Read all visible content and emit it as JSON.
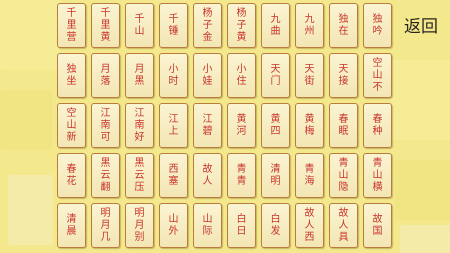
{
  "back_button": "返回",
  "cards": [
    [
      "千",
      "里",
      "营"
    ],
    [
      "千",
      "里",
      "黄"
    ],
    [
      "千",
      "山"
    ],
    [
      "千",
      "锤"
    ],
    [
      "杨",
      "子",
      "金"
    ],
    [
      "杨",
      "子",
      "黄"
    ],
    [
      "九",
      "曲"
    ],
    [
      "九",
      "州"
    ],
    [
      "独",
      "在"
    ],
    [
      "独",
      "吟"
    ],
    [
      "独",
      "坐"
    ],
    [
      "月",
      "落"
    ],
    [
      "月",
      "黑"
    ],
    [
      "小",
      "时"
    ],
    [
      "小",
      "娃"
    ],
    [
      "小",
      "住"
    ],
    [
      "天",
      "门"
    ],
    [
      "天",
      "街"
    ],
    [
      "天",
      "接"
    ],
    [
      "空",
      "山",
      "不"
    ],
    [
      "空",
      "山",
      "新"
    ],
    [
      "江",
      "南",
      "可"
    ],
    [
      "江",
      "南",
      "好"
    ],
    [
      "江",
      "上"
    ],
    [
      "江",
      "碧"
    ],
    [
      "黄",
      "河"
    ],
    [
      "黄",
      "四"
    ],
    [
      "黄",
      "梅"
    ],
    [
      "春",
      "眠"
    ],
    [
      "春",
      "种"
    ],
    [
      "春",
      "花"
    ],
    [
      "黑",
      "云",
      "翻"
    ],
    [
      "黑",
      "云",
      "压"
    ],
    [
      "西",
      "塞"
    ],
    [
      "故",
      "人"
    ],
    [
      "青",
      "青"
    ],
    [
      "清",
      "明"
    ],
    [
      "青",
      "海"
    ],
    [
      "青",
      "山",
      "隐"
    ],
    [
      "青",
      "山",
      "横"
    ],
    [
      "清",
      "晨"
    ],
    [
      "明",
      "月",
      "几"
    ],
    [
      "明",
      "月",
      "别"
    ],
    [
      "山",
      "外"
    ],
    [
      "山",
      "际"
    ],
    [
      "白",
      "日"
    ],
    [
      "白",
      "发"
    ],
    [
      "故",
      "人",
      "西"
    ],
    [
      "故",
      "人",
      "具"
    ],
    [
      "故",
      "国"
    ]
  ]
}
